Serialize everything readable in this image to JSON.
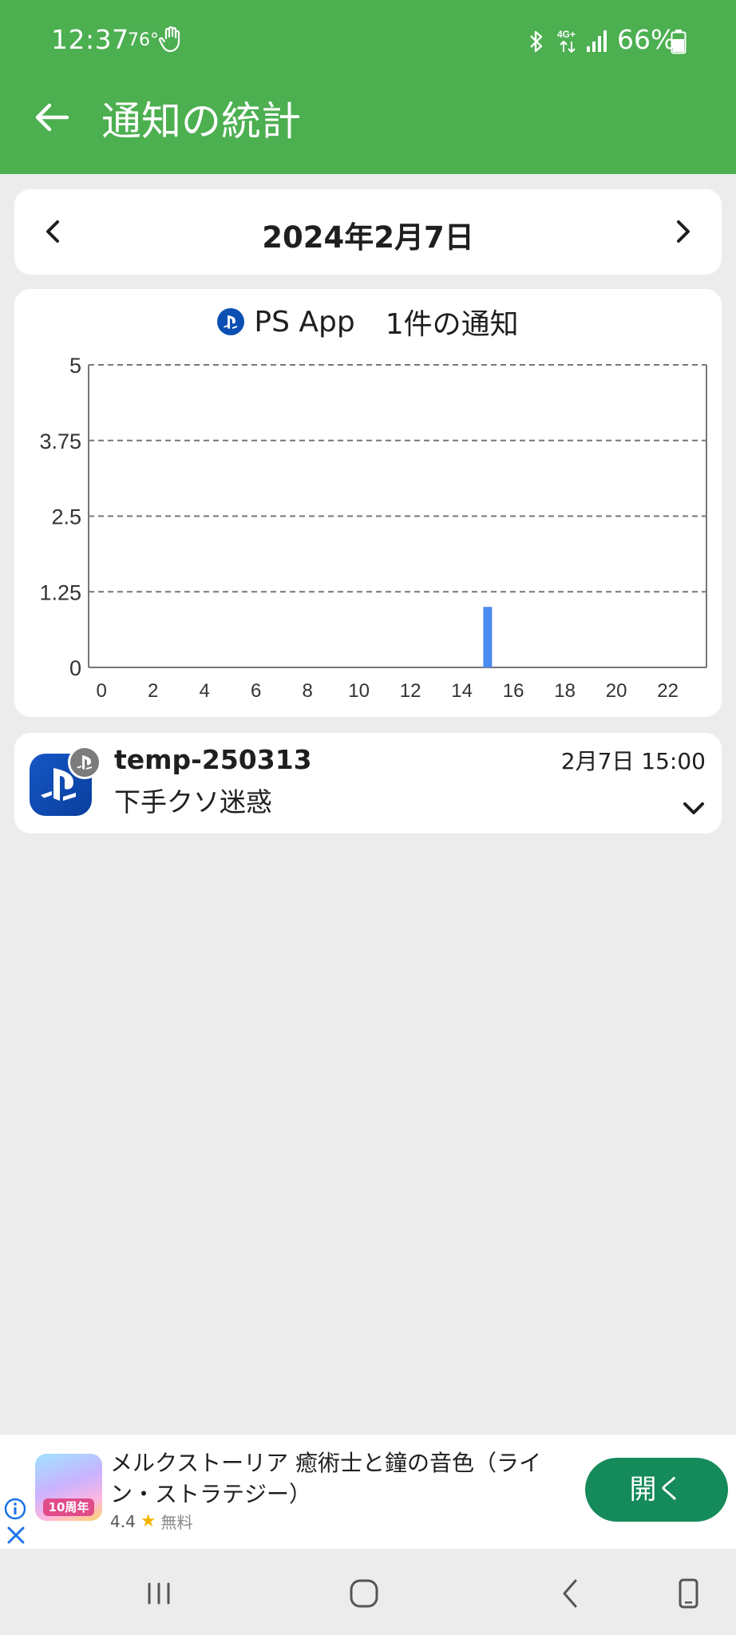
{
  "status_bar": {
    "time": "12:37",
    "temperature": "76°",
    "battery": "66%",
    "network": "4G+",
    "icons": [
      "hand-icon",
      "bluetooth-icon",
      "network-4g-icon",
      "signal-icon",
      "battery-icon"
    ]
  },
  "toolbar": {
    "title": "通知の統計",
    "back_icon": "arrow-left-icon",
    "color": "#4caf50"
  },
  "date_nav": {
    "date": "2024年2月7日",
    "prev_icon": "chevron-left-icon",
    "next_icon": "chevron-right-icon"
  },
  "chart_header": {
    "app_name": "PS App",
    "count_label": "1件の通知"
  },
  "chart_data": {
    "type": "bar",
    "x": [
      15
    ],
    "values": [
      1
    ],
    "xlim": [
      -0.5,
      23.5
    ],
    "ylim": [
      0,
      5
    ],
    "xticks": [
      "0",
      "2",
      "4",
      "6",
      "8",
      "10",
      "12",
      "14",
      "16",
      "18",
      "20",
      "22"
    ],
    "yticks": [
      "0",
      "1.25",
      "2.5",
      "3.75",
      "5"
    ],
    "grid": "horizontal dashed",
    "bar_color": "#4a8cf0"
  },
  "notification": {
    "title": "temp-250313",
    "body": "下手クソ迷惑",
    "time": "2月7日 15:00",
    "app_icon": "playstation-icon",
    "expand_icon": "chevron-down-icon"
  },
  "ad": {
    "title": "メルクストーリア 癒術士と鐘の音色（ライン・ストラテジー）",
    "rating": "4.4",
    "price": "無料",
    "icon_badge": "10周年",
    "button": "開く",
    "button_color": "#158a5a"
  },
  "nav_bar": {
    "icons": [
      "recents-icon",
      "home-icon",
      "back-icon",
      "rotate-icon"
    ]
  }
}
